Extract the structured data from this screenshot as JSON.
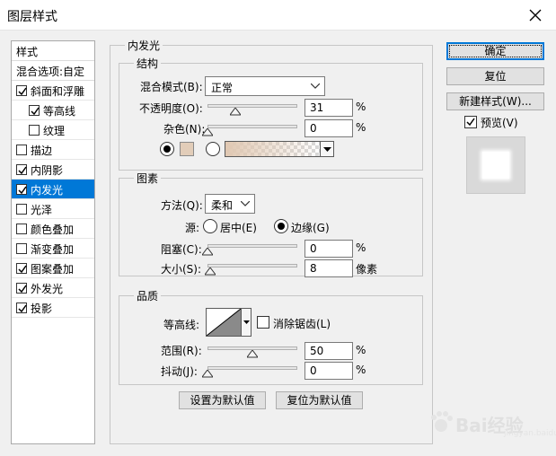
{
  "window": {
    "title": "图层样式"
  },
  "sidebar": {
    "header": "样式",
    "blend_options": "混合选项:自定",
    "items": [
      {
        "label": "斜面和浮雕",
        "checked": true,
        "selected": false,
        "indent": false
      },
      {
        "label": "等高线",
        "checked": true,
        "selected": false,
        "indent": true
      },
      {
        "label": "纹理",
        "checked": false,
        "selected": false,
        "indent": true
      },
      {
        "label": "描边",
        "checked": false,
        "selected": false,
        "indent": false
      },
      {
        "label": "内阴影",
        "checked": true,
        "selected": false,
        "indent": false
      },
      {
        "label": "内发光",
        "checked": true,
        "selected": true,
        "indent": false
      },
      {
        "label": "光泽",
        "checked": false,
        "selected": false,
        "indent": false
      },
      {
        "label": "颜色叠加",
        "checked": false,
        "selected": false,
        "indent": false
      },
      {
        "label": "渐变叠加",
        "checked": false,
        "selected": false,
        "indent": false
      },
      {
        "label": "图案叠加",
        "checked": true,
        "selected": false,
        "indent": false
      },
      {
        "label": "外发光",
        "checked": true,
        "selected": false,
        "indent": false
      },
      {
        "label": "投影",
        "checked": true,
        "selected": false,
        "indent": false
      }
    ]
  },
  "panel": {
    "title": "内发光",
    "structure": {
      "title": "结构",
      "blend_mode_label": "混合模式(B):",
      "blend_mode_value": "正常",
      "opacity_label": "不透明度(O):",
      "opacity_value": "31",
      "opacity_unit": "%",
      "noise_label": "杂色(N):",
      "noise_value": "0",
      "noise_unit": "%",
      "solid_color": "#e2cdb9",
      "gradient_start": "#e0c8b2",
      "mode": "solid"
    },
    "elements": {
      "title": "图素",
      "method_label": "方法(Q):",
      "method_value": "柔和",
      "source_label": "源:",
      "source_center": "居中(E)",
      "source_edge": "边缘(G)",
      "source_selected": "edge",
      "choke_label": "阻塞(C):",
      "choke_value": "0",
      "choke_unit": "%",
      "size_label": "大小(S):",
      "size_value": "8",
      "size_unit": "像素"
    },
    "quality": {
      "title": "品质",
      "contour_label": "等高线:",
      "antialias_label": "消除锯齿(L)",
      "antialias_checked": false,
      "range_label": "范围(R):",
      "range_value": "50",
      "range_unit": "%",
      "jitter_label": "抖动(J):",
      "jitter_value": "0",
      "jitter_unit": "%"
    },
    "make_default": "设置为默认值",
    "reset_default": "复位为默认值"
  },
  "buttons": {
    "ok": "确定",
    "reset": "复位",
    "new_style": "新建样式(W)...",
    "preview_label": "预览(V)",
    "preview_checked": true
  },
  "watermark": {
    "text": "Bai经验",
    "sub": "jingyan.baidu.com"
  },
  "colors": {
    "selection": "#0078d7",
    "dialog_bg": "#f0f0f0"
  }
}
